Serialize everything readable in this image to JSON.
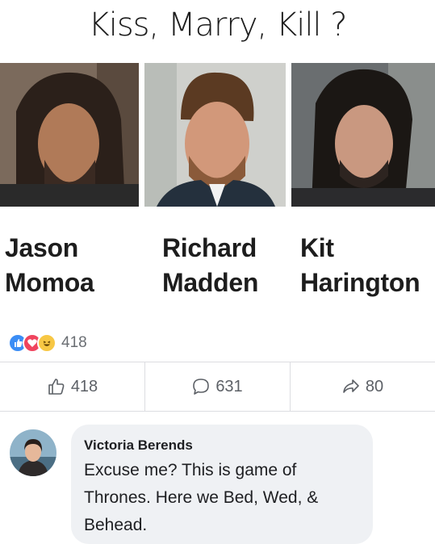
{
  "post": {
    "title": "Kiss, Marry, Kill ?",
    "people": [
      {
        "first": "Jason",
        "last": "Momoa"
      },
      {
        "first": "Richard",
        "last": "Madden"
      },
      {
        "first": "Kit",
        "last": "Harington"
      }
    ],
    "reactions": {
      "icons": [
        "like-icon",
        "love-icon",
        "haha-icon"
      ],
      "count": "418"
    },
    "actions": {
      "like_count": "418",
      "comment_count": "631",
      "share_count": "80"
    }
  },
  "comment": {
    "author": "Victoria Berends",
    "text": "Excuse me? This is game of Thrones. Here we Bed, Wed, & Behead."
  },
  "colors": {
    "like_blue": "#3b8df5",
    "love_red": "#f0445e",
    "haha_yellow": "#f7c744",
    "bubble_bg": "#eff1f4"
  }
}
